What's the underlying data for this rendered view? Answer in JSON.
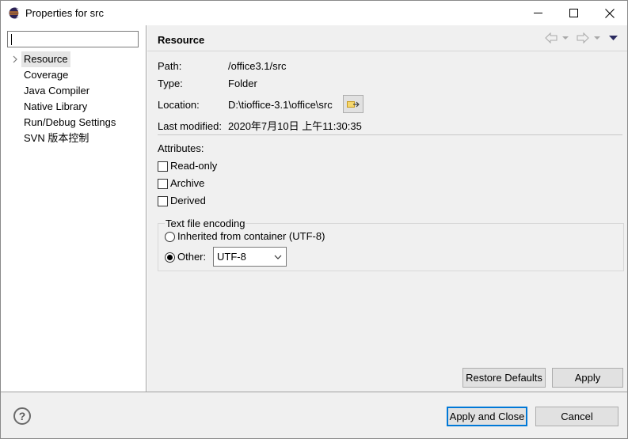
{
  "window": {
    "title": "Properties for src",
    "app_icon": "eclipse-icon",
    "controls": [
      "minimize-icon",
      "maximize-icon",
      "close-icon"
    ]
  },
  "sidebar": {
    "filter_value": "",
    "items": [
      {
        "label": "Resource",
        "selected": true,
        "expandable": true
      },
      {
        "label": "Coverage"
      },
      {
        "label": "Java Compiler"
      },
      {
        "label": "Native Library"
      },
      {
        "label": "Run/Debug Settings"
      },
      {
        "label": "SVN 版本控制"
      }
    ]
  },
  "page": {
    "title": "Resource",
    "nav_icons": [
      "back-arrow-icon",
      "back-dropdown-icon",
      "forward-arrow-icon",
      "forward-dropdown-icon",
      "view-menu-icon"
    ]
  },
  "info": {
    "path_label": "Path:",
    "path_value": "/office3.1/src",
    "type_label": "Type:",
    "type_value": "Folder",
    "location_label": "Location:",
    "location_value": "D:\\tioffice-3.1\\office\\src",
    "modified_label": "Last modified:",
    "modified_value": "2020年7月10日 上午11:30:35"
  },
  "attributes": {
    "heading": "Attributes:",
    "readonly": "Read-only",
    "archive": "Archive",
    "derived": "Derived"
  },
  "encoding": {
    "legend": "Text file encoding",
    "inherited": "Inherited from container (UTF-8)",
    "other": "Other:",
    "other_selected": true,
    "selected_value": "UTF-8"
  },
  "buttons": {
    "restore_defaults": "Restore Defaults",
    "apply": "Apply",
    "apply_and_close": "Apply and Close",
    "cancel": "Cancel",
    "help": "?"
  },
  "colors": {
    "accent": "#0078d7",
    "panel_bg": "#f0f0f0",
    "selection_bg": "#e5e5e5"
  }
}
